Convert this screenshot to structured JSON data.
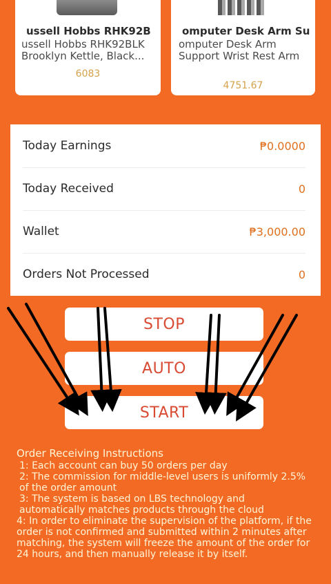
{
  "products": [
    {
      "name": "ussell Hobbs RHK92B",
      "description": "ussell Hobbs RHK92BLK Brooklyn Kettle, Black...",
      "price": "6083"
    },
    {
      "name": "omputer Desk Arm Su",
      "description": "omputer Desk Arm Support Wrist Rest Arm Rest One-Axis...",
      "price": "4751.67"
    }
  ],
  "stats": [
    {
      "label": "Today Earnings",
      "value": "₱0.0000"
    },
    {
      "label": "Today Received",
      "value": "0"
    },
    {
      "label": "Wallet",
      "value": "₱3,000.00"
    },
    {
      "label": "Orders Not Processed",
      "value": "0"
    }
  ],
  "buttons": {
    "stop": "STOP",
    "auto": "AUTO",
    "start": "START"
  },
  "instructions": {
    "title": "Order Receiving Instructions",
    "items": [
      "1: Each account can buy 50 orders per day",
      "2: The commission for middle-level users is uniformly 2.5% of the order amount",
      "3: The system is based on LBS technology and automatically matches products through the cloud",
      "4: In order to eliminate the supervision of the platform, if the order is not confirmed and submitted within 2 minutes after matching, the system will freeze the amount of the order for 24 hours, and then manually release it by itself."
    ]
  },
  "colors": {
    "background": "#f26a23",
    "stat_value": "#e0701d",
    "button_text": "#d94a33",
    "price": "#d4a24a",
    "annotation_arrows": "#000000"
  }
}
